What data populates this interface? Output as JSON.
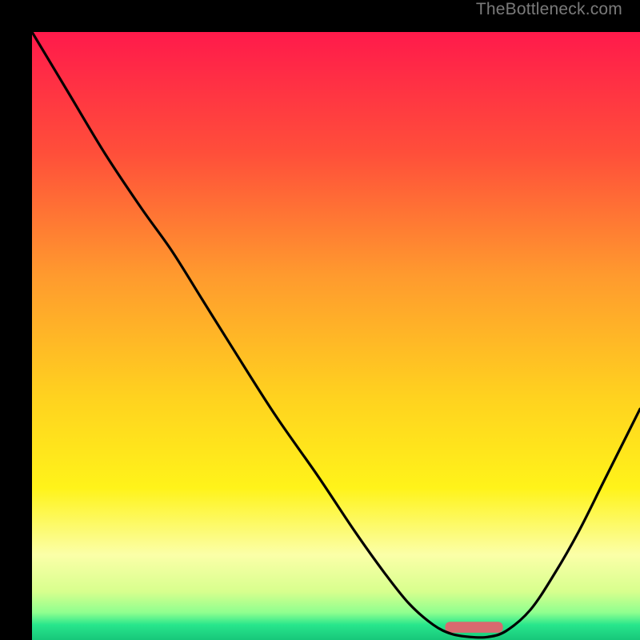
{
  "watermark": "TheBottleneck.com",
  "chart_data": {
    "type": "line",
    "title": "",
    "xlabel": "",
    "ylabel": "",
    "xlim": [
      0,
      100
    ],
    "ylim": [
      0,
      100
    ],
    "grid": false,
    "legend": false,
    "background_gradient": {
      "stops": [
        {
          "offset": 0.0,
          "color": "#ff1a4b"
        },
        {
          "offset": 0.2,
          "color": "#ff4f3a"
        },
        {
          "offset": 0.4,
          "color": "#ff9a2e"
        },
        {
          "offset": 0.6,
          "color": "#ffd21f"
        },
        {
          "offset": 0.75,
          "color": "#fff31a"
        },
        {
          "offset": 0.86,
          "color": "#fbffa8"
        },
        {
          "offset": 0.92,
          "color": "#d8ff8e"
        },
        {
          "offset": 0.955,
          "color": "#8fff8f"
        },
        {
          "offset": 0.975,
          "color": "#28e68c"
        },
        {
          "offset": 1.0,
          "color": "#17c77a"
        }
      ]
    },
    "curve_points": [
      {
        "x": 0.0,
        "y": 100.0
      },
      {
        "x": 6.0,
        "y": 90.0
      },
      {
        "x": 12.0,
        "y": 80.0
      },
      {
        "x": 18.0,
        "y": 71.0
      },
      {
        "x": 23.0,
        "y": 64.0
      },
      {
        "x": 28.0,
        "y": 56.0
      },
      {
        "x": 33.0,
        "y": 48.0
      },
      {
        "x": 40.0,
        "y": 37.0
      },
      {
        "x": 47.0,
        "y": 27.0
      },
      {
        "x": 53.0,
        "y": 18.0
      },
      {
        "x": 58.0,
        "y": 11.0
      },
      {
        "x": 62.0,
        "y": 6.0
      },
      {
        "x": 66.0,
        "y": 2.5
      },
      {
        "x": 69.0,
        "y": 1.0
      },
      {
        "x": 72.0,
        "y": 0.5
      },
      {
        "x": 75.0,
        "y": 0.5
      },
      {
        "x": 78.0,
        "y": 1.5
      },
      {
        "x": 82.0,
        "y": 5.0
      },
      {
        "x": 86.0,
        "y": 11.0
      },
      {
        "x": 90.0,
        "y": 18.0
      },
      {
        "x": 94.0,
        "y": 26.0
      },
      {
        "x": 98.0,
        "y": 34.0
      },
      {
        "x": 100.0,
        "y": 38.0
      }
    ],
    "marker": {
      "x_center": 72.7,
      "y": 2.1,
      "width": 9.5,
      "height": 1.8,
      "color": "#d9696f"
    }
  }
}
